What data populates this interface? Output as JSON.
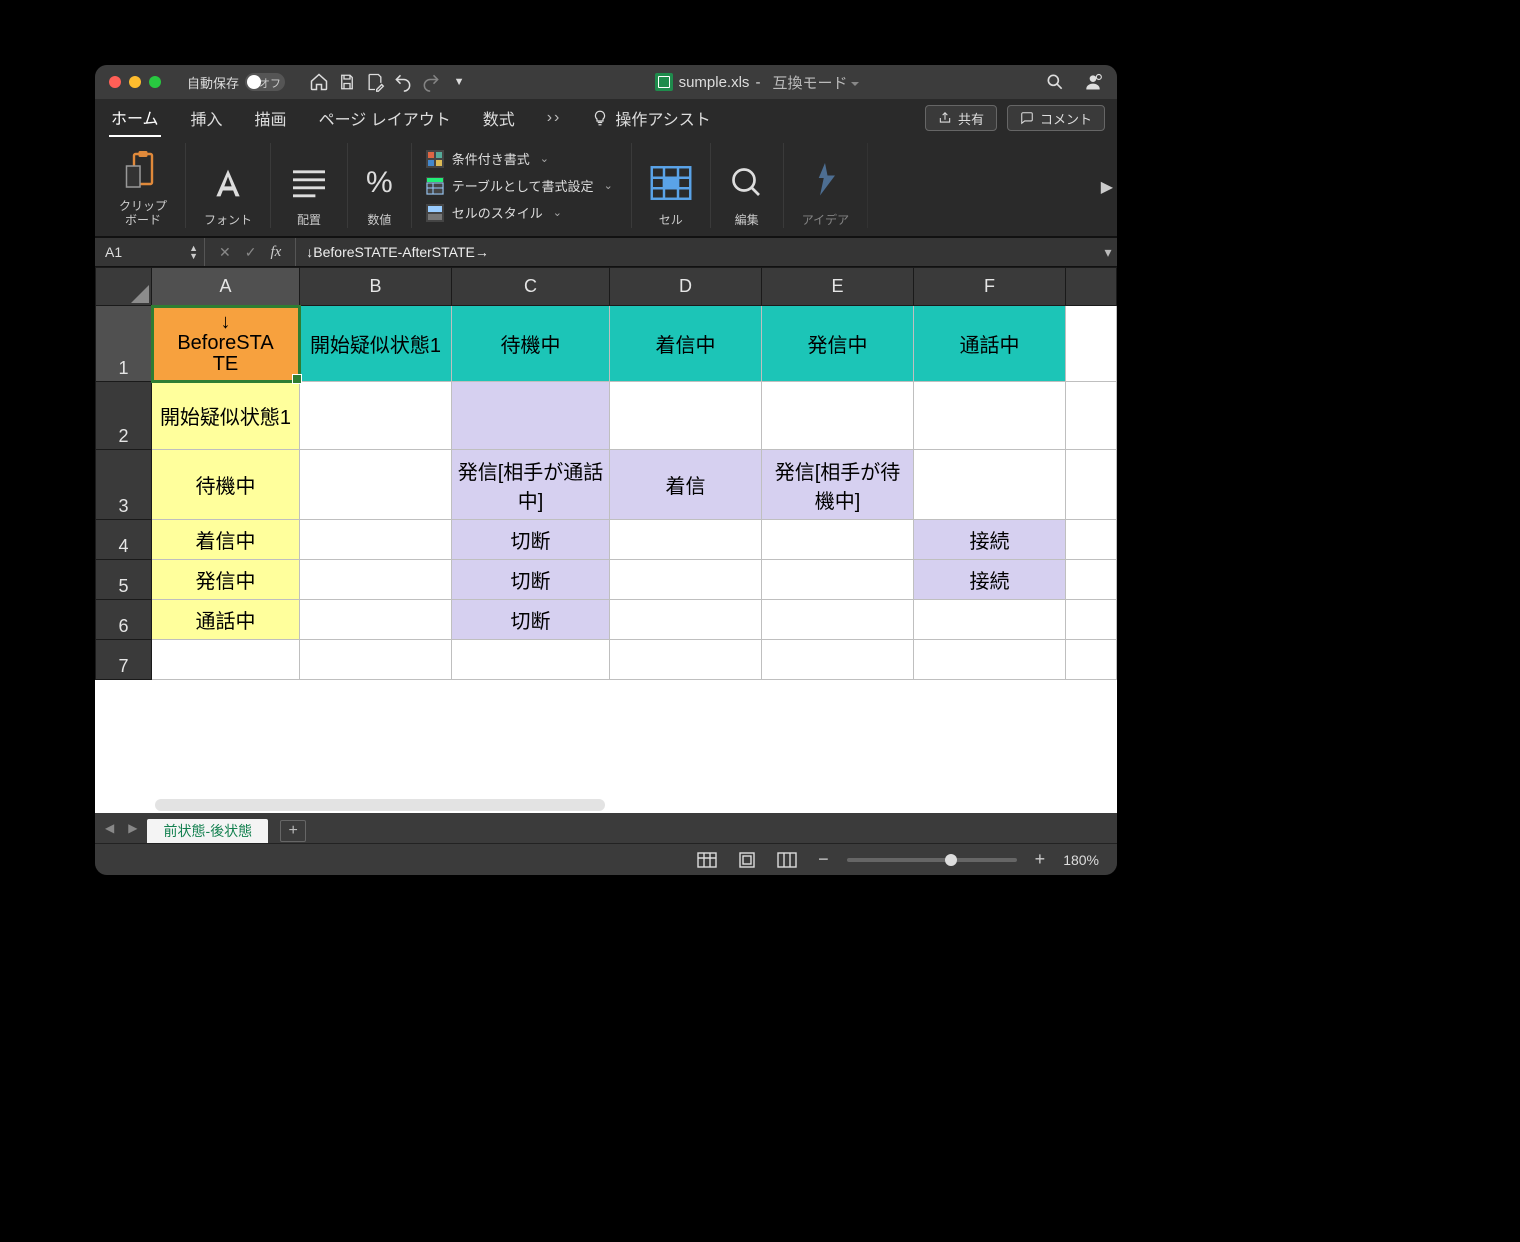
{
  "titlebar": {
    "auto_save_label": "自動保存",
    "auto_save_state": "オフ",
    "filename": "sumple.xls",
    "compat": "互換モード"
  },
  "tabs": {
    "home": "ホーム",
    "insert": "挿入",
    "draw": "描画",
    "layout": "ページ レイアウト",
    "formulas": "数式",
    "assist": "操作アシスト",
    "share": "共有",
    "comments": "コメント"
  },
  "ribbon": {
    "clipboard": "クリップ\nボード",
    "font": "フォント",
    "align": "配置",
    "number": "数値",
    "cond": "条件付き書式",
    "table_fmt": "テーブルとして書式設定",
    "cell_style": "セルのスタイル",
    "cells": "セル",
    "edit": "編集",
    "ideas": "アイデア"
  },
  "fbar": {
    "cell": "A1",
    "formula": "↓BeforeSTATE-AfterSTATE→"
  },
  "columns": [
    "A",
    "B",
    "C",
    "D",
    "E",
    "F"
  ],
  "row_numbers": [
    "1",
    "2",
    "3",
    "4",
    "5",
    "6",
    "7"
  ],
  "a1": {
    "line1": "↓",
    "line2": "BeforeSTA",
    "line3": "TE"
  },
  "headers": {
    "b": "開始疑似状態1",
    "c": "待機中",
    "d": "着信中",
    "e": "発信中",
    "f": "通話中"
  },
  "row_labels": {
    "r2": "開始疑似状態1",
    "r3": "待機中",
    "r4": "着信中",
    "r5": "発信中",
    "r6": "通話中"
  },
  "cells": {
    "r3c": "発信[相手が通話中]",
    "r3d": "着信",
    "r3e": "発信[相手が待機中]",
    "r4c": "切断",
    "r4f": "接続",
    "r5c": "切断",
    "r5f": "接続",
    "r6c": "切断"
  },
  "sheet_tab": "前状態-後状態",
  "status": {
    "zoom": "180%"
  }
}
